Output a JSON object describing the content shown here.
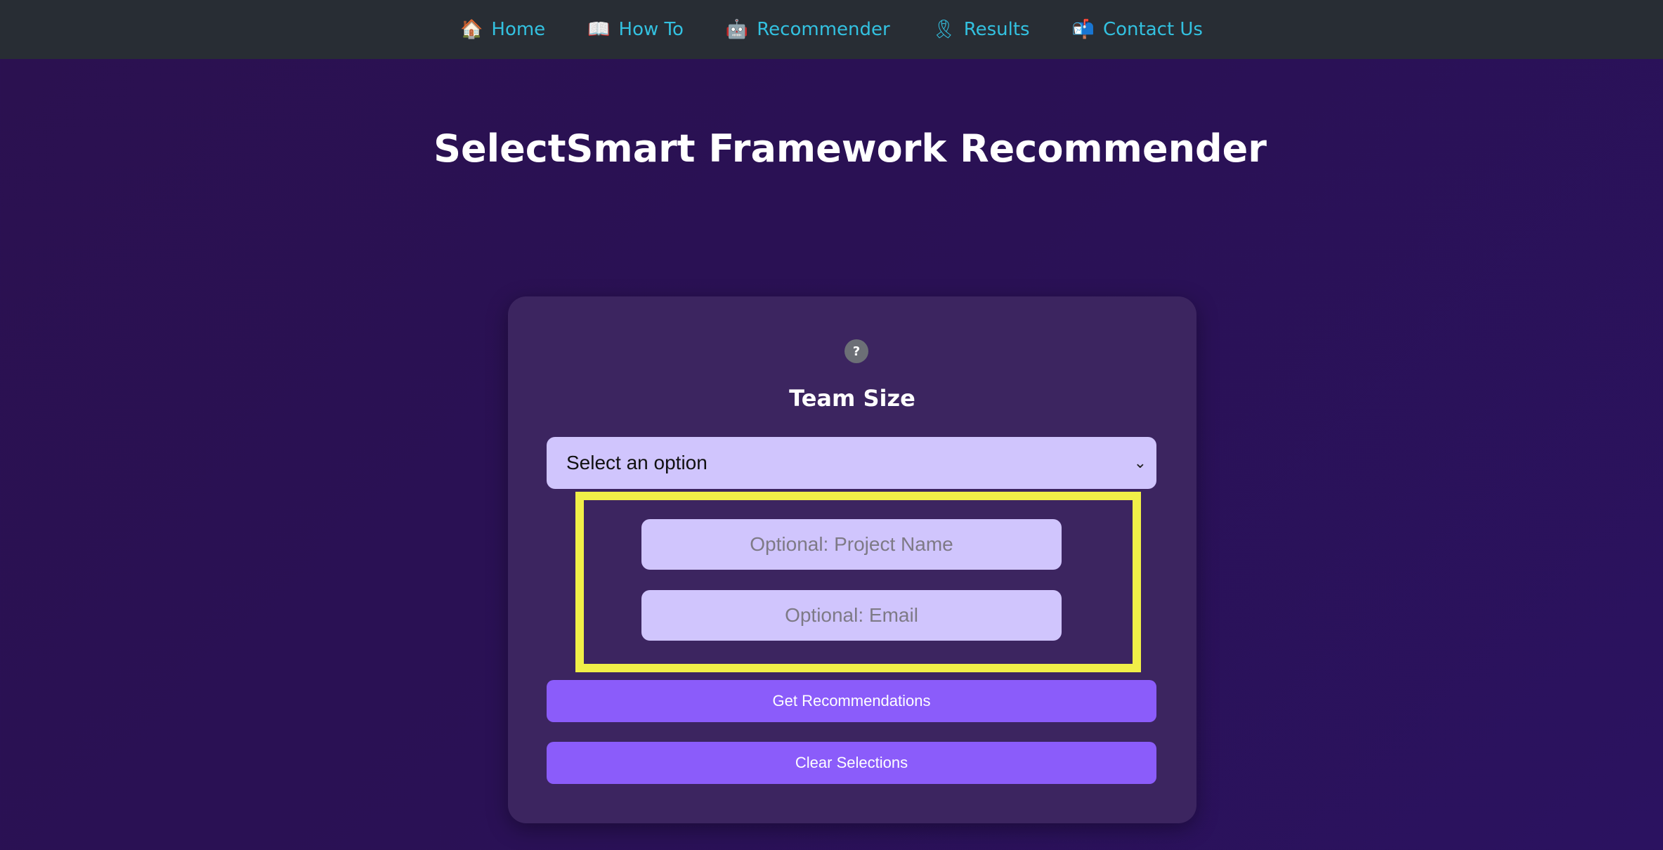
{
  "nav": {
    "items": [
      {
        "icon": "🏠",
        "label": "Home"
      },
      {
        "icon": "📖",
        "label": "How To"
      },
      {
        "icon": "🤖",
        "label": "Recommender"
      },
      {
        "icon": "🎗",
        "label": "Results"
      },
      {
        "icon": "📬",
        "label": "Contact Us"
      }
    ]
  },
  "page": {
    "title": "SelectSmart Framework Recommender"
  },
  "form": {
    "help_symbol": "?",
    "label": "Team Size",
    "select_value": "Select an option",
    "project_placeholder": "Optional: Project Name",
    "email_placeholder": "Optional: Email",
    "get_button": "Get Recommendations",
    "clear_button": "Clear Selections"
  },
  "colors": {
    "nav_bg": "#282d34",
    "nav_link": "#33c1e0",
    "page_bg": "#2b1150",
    "card_bg": "#3c2560",
    "input_bg": "#d0c5fd",
    "button_bg": "#8b5cfa",
    "highlight": "#f1ef48"
  }
}
